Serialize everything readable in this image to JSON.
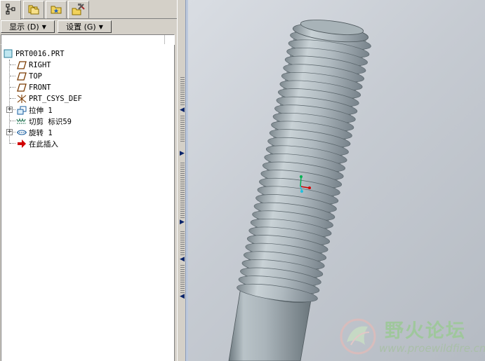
{
  "navigator": {
    "tabs": [
      {
        "icon": "model-tree-icon",
        "active": true
      },
      {
        "icon": "folder-browser-icon",
        "active": false
      },
      {
        "icon": "favorites-folder-icon",
        "active": false
      },
      {
        "icon": "tools-icon",
        "active": false
      }
    ],
    "show_menu_label": "显示 (D)",
    "settings_menu_label": "设置 (G)"
  },
  "model_tree": {
    "root": {
      "label": "PRT0016.PRT",
      "icon": "part-icon"
    },
    "items": [
      {
        "label": "RIGHT",
        "icon": "datum-plane-icon",
        "expandable": false
      },
      {
        "label": "TOP",
        "icon": "datum-plane-icon",
        "expandable": false
      },
      {
        "label": "FRONT",
        "icon": "datum-plane-icon",
        "expandable": false
      },
      {
        "label": "PRT_CSYS_DEF",
        "icon": "coordinate-system-icon",
        "expandable": false
      },
      {
        "label": "拉伸 1",
        "icon": "extrude-icon",
        "expandable": true
      },
      {
        "label": "切剪 标识59",
        "icon": "cut-thread-icon",
        "expandable": false
      },
      {
        "label": "旋转 1",
        "icon": "revolve-icon",
        "expandable": true
      },
      {
        "label": "在此插入",
        "icon": "insert-here-arrow-icon",
        "expandable": false
      }
    ]
  },
  "viewport": {
    "background_color": "#c8cdd4",
    "model": "threaded-bolt",
    "watermark_title": "野火论坛",
    "watermark_url": "www.proewildfire.cn"
  }
}
